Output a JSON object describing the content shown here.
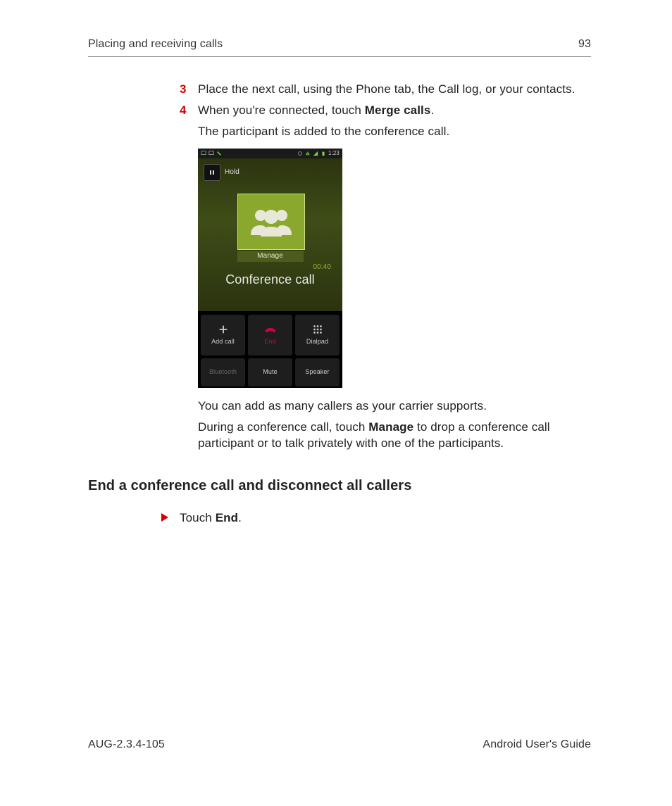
{
  "header": {
    "section": "Placing and receiving calls",
    "page_number": "93"
  },
  "steps": [
    {
      "num": "3",
      "text_before": "Place the next call, using the Phone tab, the Call log, or your contacts.",
      "bold": "",
      "text_after": ""
    },
    {
      "num": "4",
      "text_before": "When you're connected, touch ",
      "bold": "Merge calls",
      "text_after": "."
    }
  ],
  "sub_after_step4": "The participant is added to the conference call.",
  "phone": {
    "status_time": "1:23",
    "hold_label": "Hold",
    "manage_label": "Manage",
    "call_timer": "00:40",
    "title": "Conference call",
    "buttons": {
      "add": "Add call",
      "end": "End",
      "dialpad": "Dialpad",
      "bluetooth": "Bluetooth",
      "mute": "Mute",
      "speaker": "Speaker"
    }
  },
  "after_shot_1": "You can add as many callers as your carrier supports.",
  "after_shot_2_before": "During a conference call, touch ",
  "after_shot_2_bold": "Manage",
  "after_shot_2_after": " to drop a conference call participant or to talk privately with one of the participants.",
  "heading": "End a conference call and disconnect all callers",
  "end_bullet_before": "Touch ",
  "end_bullet_bold": "End",
  "end_bullet_after": ".",
  "footer": {
    "left": "AUG-2.3.4-105",
    "right": "Android User's Guide"
  }
}
